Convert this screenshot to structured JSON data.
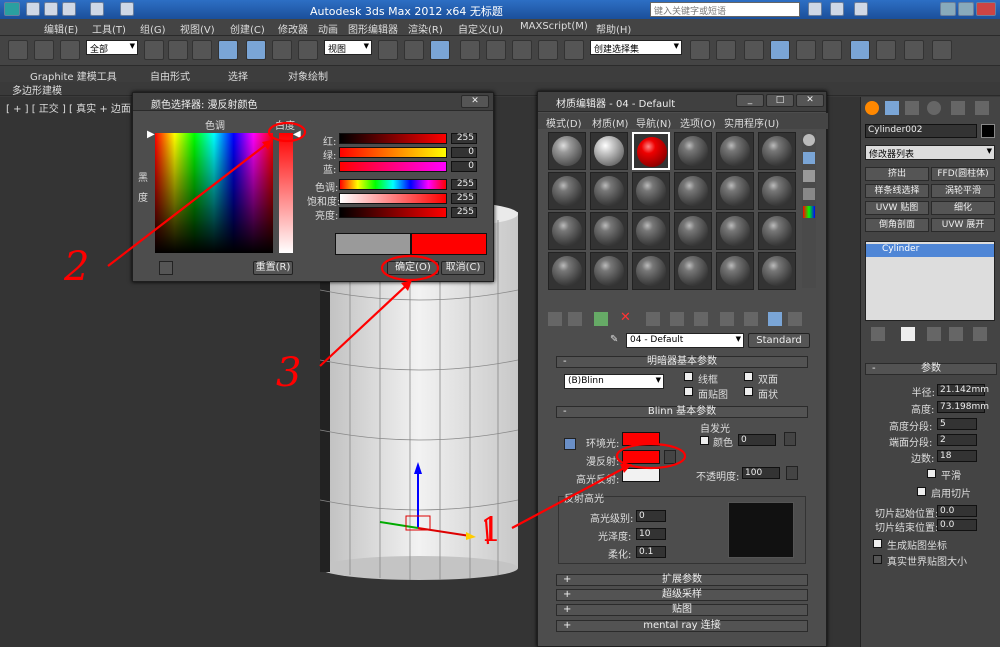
{
  "app": {
    "title": "Autodesk 3ds Max  2012 x64      无标题",
    "search_placeholder": "键入关键字或短语"
  },
  "menu": [
    "编辑(E)",
    "工具(T)",
    "组(G)",
    "视图(V)",
    "创建(C)",
    "修改器",
    "动画",
    "图形编辑器",
    "渲染(R)",
    "自定义(U)",
    "MAXScript(M)",
    "帮助(H)"
  ],
  "toolbar": {
    "filter": "全部",
    "view": "视图",
    "selset": "创建选择集"
  },
  "ribbon": {
    "tabs": [
      "Graphite 建模工具",
      "自由形式",
      "选择",
      "对象绘制"
    ],
    "sub": "多边形建模"
  },
  "viewport": {
    "label": "[ + ] [ 正交 ] [ 真实 + 边面 ]"
  },
  "colorpicker": {
    "title": "颜色选择器: 漫反射颜色",
    "hue_label": "色调",
    "white_label": "白度",
    "black_label": "黑",
    "degree_label": "度",
    "rows": [
      {
        "label": "红:",
        "value": "255"
      },
      {
        "label": "绿:",
        "value": "0"
      },
      {
        "label": "蓝:",
        "value": "0"
      },
      {
        "label": "色调:",
        "value": "255"
      },
      {
        "label": "饱和度:",
        "value": "255"
      },
      {
        "label": "亮度:",
        "value": "255"
      }
    ],
    "reset": "重置(R)",
    "ok": "确定(O)",
    "cancel": "取消(C)"
  },
  "mateditor": {
    "title": "材质编辑器 - 04 - Default",
    "menu": [
      "模式(D)",
      "材质(M)",
      "导航(N)",
      "选项(O)",
      "实用程序(U)"
    ],
    "matname": "04 - Default",
    "mattype": "Standard",
    "shader_rollout": "明暗器基本参数",
    "shader": "(B)Blinn",
    "opts": [
      "线框",
      "双面",
      "面贴图",
      "面状"
    ],
    "blinn_rollout": "Blinn 基本参数",
    "selfillum": "自发光",
    "color_label": "颜色",
    "selfillum_val": "0",
    "ambient": "环境光:",
    "diffuse": "漫反射:",
    "specular": "高光反射:",
    "opacity_label": "不透明度:",
    "opacity": "100",
    "spec_group": "反射高光",
    "spec_level": "高光级别:",
    "spec_level_val": "0",
    "gloss": "光泽度:",
    "gloss_val": "10",
    "soften": "柔化:",
    "soften_val": "0.1",
    "rollouts": [
      "扩展参数",
      "超级采样",
      "贴图",
      "mental ray 连接"
    ]
  },
  "cmd": {
    "objname": "Cylinder002",
    "modlist": "修改器列表",
    "buttons": [
      "挤出",
      "FFD(圆柱体)",
      "样条线选择",
      "涡轮平滑",
      "UVW 贴图",
      "细化",
      "倒角剖面",
      "UVW 展开"
    ],
    "stack": "Cylinder",
    "params_rollout": "参数",
    "params": [
      {
        "label": "半径:",
        "value": "21.142mm"
      },
      {
        "label": "高度:",
        "value": "73.198mm"
      },
      {
        "label": "高度分段:",
        "value": "5"
      },
      {
        "label": "端面分段:",
        "value": "2"
      },
      {
        "label": "边数:",
        "value": "18"
      }
    ],
    "smooth": "平滑",
    "slice": "启用切片",
    "slice_from": "切片起始位置:",
    "slice_to": "切片结束位置:",
    "slice_from_val": "0.0",
    "slice_to_val": "0.0",
    "gen_uv": "生成贴图坐标",
    "realworld": "真实世界贴图大小"
  },
  "annotations": {
    "n1": "1",
    "n2": "2",
    "n3": "3"
  },
  "colors": {
    "red": "#ff0000",
    "accent": "#2d6fc4"
  }
}
